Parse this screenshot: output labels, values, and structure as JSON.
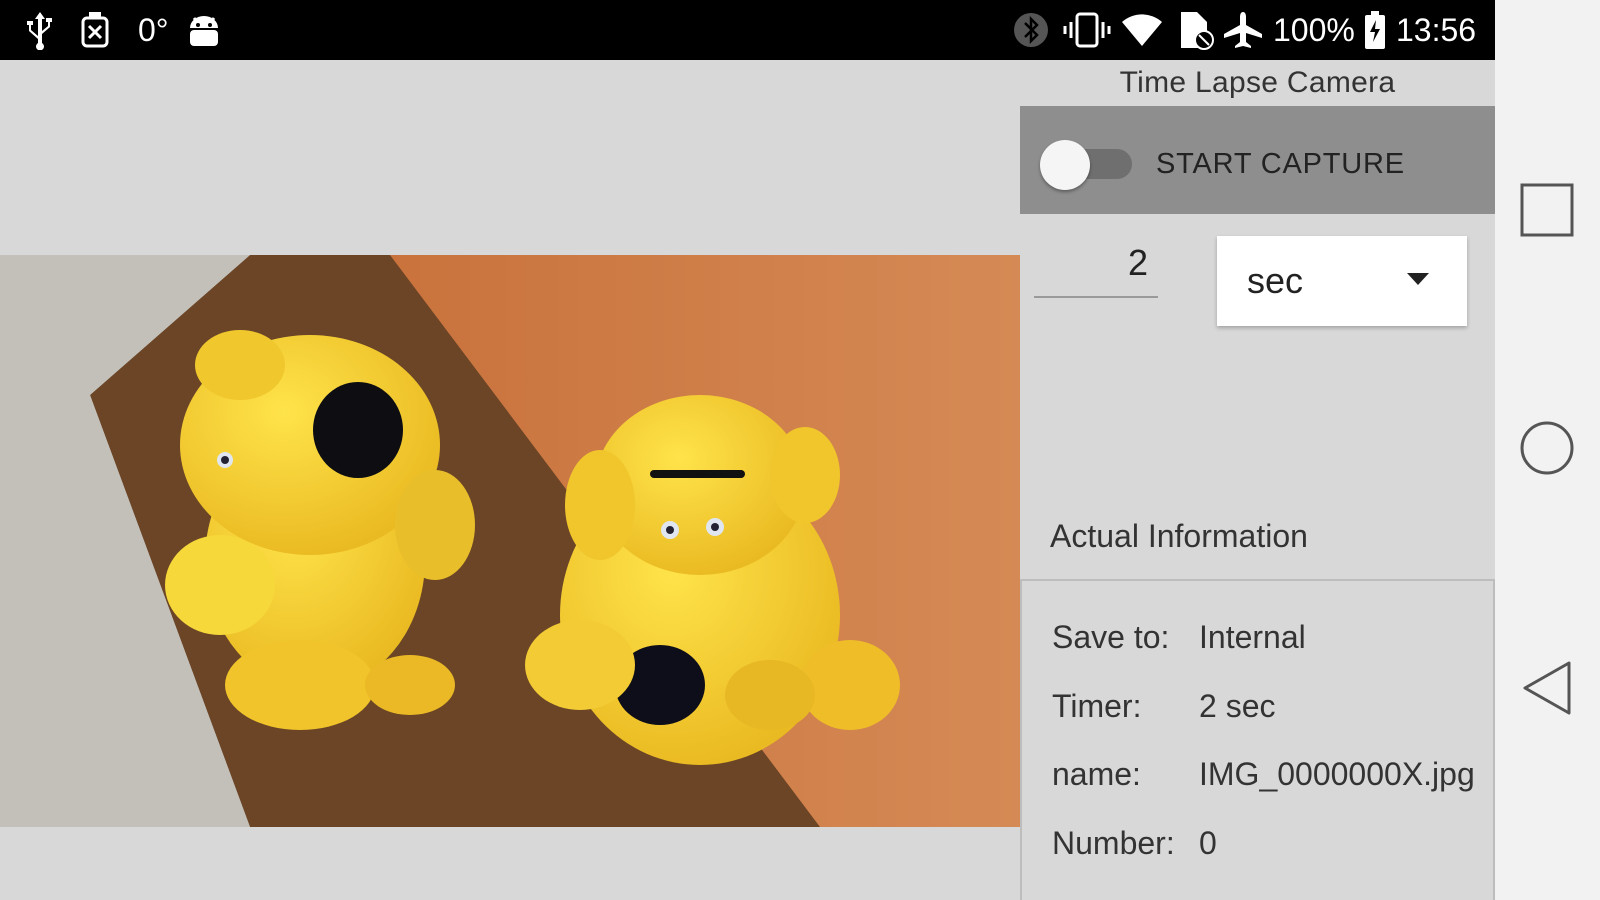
{
  "status_bar": {
    "temperature": "0°",
    "battery_percent": "100%",
    "time": "13:56",
    "left_icons": [
      "usb-icon",
      "cleaner-icon",
      "android-debug-icon"
    ],
    "right_icons": [
      "bluetooth-icon",
      "vibrate-icon",
      "wifi-icon",
      "no-sim-icon",
      "airplane-icon",
      "battery-icon"
    ]
  },
  "app": {
    "title": "Time Lapse Camera",
    "capture_toggle": {
      "label": "START CAPTURE",
      "on": false
    },
    "interval": {
      "value": "2"
    },
    "unit_select": {
      "selected": "sec"
    },
    "info": {
      "heading": "Actual Information",
      "rows": [
        {
          "key": "Save to:",
          "value": "Internal"
        },
        {
          "key": "Timer:",
          "value": "2 sec"
        },
        {
          "key": "name:",
          "value": "IMG_0000000X.jpg"
        },
        {
          "key": "Number:",
          "value": "0"
        }
      ]
    }
  },
  "nav_bar": {
    "buttons": [
      "recents-icon",
      "home-icon",
      "back-icon"
    ]
  },
  "colors": {
    "status_bar": "#000000",
    "background": "#d8d8d8",
    "capture_bar": "#8e8e8e",
    "nav_bar": "#f2f2f2"
  }
}
